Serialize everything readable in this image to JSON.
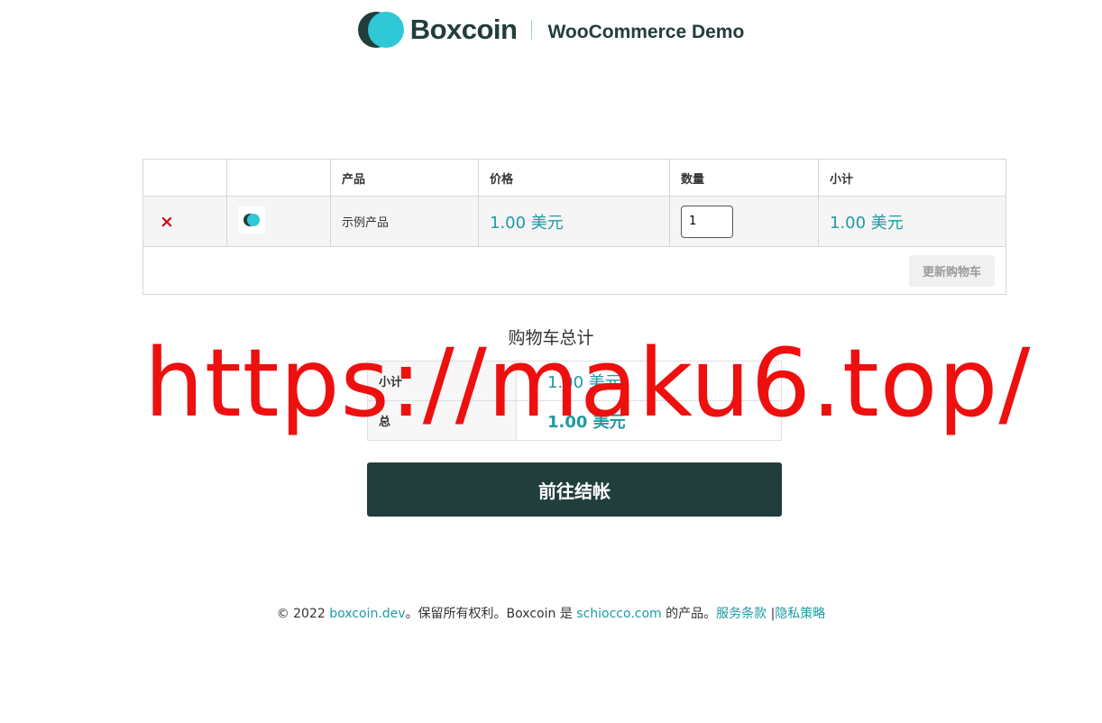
{
  "header": {
    "brand": "Boxcoin",
    "store": "WooCommerce Demo"
  },
  "cart": {
    "columns": [
      "",
      "",
      "产品",
      "价格",
      "数量",
      "小计"
    ],
    "items": [
      {
        "remove": "×",
        "thumbnail_icon": "boxcoin-logo-icon",
        "name": "示例产品",
        "price": "1.00 美元",
        "quantity": "1",
        "subtotal": "1.00 美元"
      }
    ],
    "update_label": "更新购物车"
  },
  "totals": {
    "title": "购物车总计",
    "subtotal_label": "小计",
    "subtotal_value": "1.00 美元",
    "total_label": "总",
    "total_value": "1.00 美元",
    "checkout_label": "前往结帐"
  },
  "footer": {
    "copyright": "© 2022 ",
    "site_link": "boxcoin.dev",
    "rights": "。保留所有权利。Boxcoin 是 ",
    "company_link": "schiocco.com",
    "product_of": " 的产品。",
    "terms_link": "服务条款",
    "separator": " |",
    "privacy_link": "隐私策略"
  },
  "watermark": {
    "text": "https://maku6.top/"
  },
  "colors": {
    "brand_dark": "#213e3c",
    "brand_accent": "#2ec8d6",
    "link": "#1f9aa4",
    "remove": "#d0021b",
    "watermark": "#ee0f0f"
  }
}
